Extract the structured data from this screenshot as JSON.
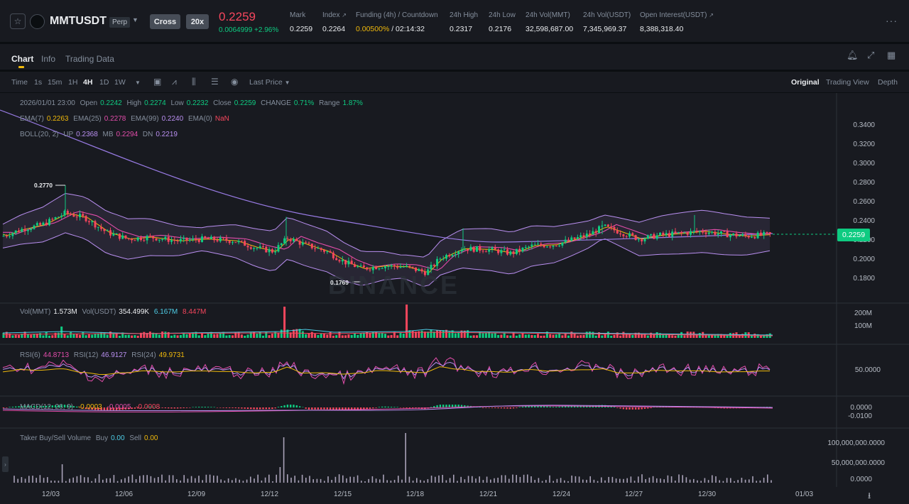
{
  "header": {
    "symbol": "MMTUSDT",
    "contract_type": "Perp",
    "margin_mode": "Cross",
    "leverage": "20x",
    "last_price": "0.2259",
    "price_change": "0.0064999 +2.96%",
    "stats": [
      {
        "label": "Mark",
        "value": "0.2259"
      },
      {
        "label": "Index",
        "value": "0.2264"
      },
      {
        "label": "Funding (4h) / Countdown",
        "value_funding": "0.00500%",
        "value_countdown": "/ 02:14:32"
      },
      {
        "label": "24h High",
        "value": "0.2317"
      },
      {
        "label": "24h Low",
        "value": "0.2176"
      },
      {
        "label": "24h Vol(MMT)",
        "value": "32,598,687.00"
      },
      {
        "label": "24h Vol(USDT)",
        "value": "7,345,969.37"
      },
      {
        "label": "Open Interest(USDT)",
        "value": "8,388,318.40"
      }
    ]
  },
  "tabs": [
    "Chart",
    "Info",
    "Trading Data"
  ],
  "toolbar": {
    "intervals": [
      "Time",
      "1s",
      "15m",
      "1H",
      "4H",
      "1D",
      "1W"
    ],
    "active_interval": "4H",
    "price_type": "Last Price",
    "views": [
      "Original",
      "Trading View",
      "Depth"
    ],
    "active_view": "Original"
  },
  "legend": {
    "ohlc": {
      "date": "2026/01/01 23:00",
      "open_label": "Open",
      "open": "0.2242",
      "high_label": "High",
      "high": "0.2274",
      "low_label": "Low",
      "low": "0.2232",
      "close_label": "Close",
      "close": "0.2259",
      "change_label": "CHANGE",
      "change": "0.71%",
      "range_label": "Range",
      "range": "1.87%"
    },
    "ema": {
      "ema7_label": "EMA(7)",
      "ema7": "0.2263",
      "ema25_label": "EMA(25)",
      "ema25": "0.2278",
      "ema99_label": "EMA(99)",
      "ema99": "0.2240",
      "ema0_label": "EMA(0)",
      "ema0": "NaN"
    },
    "boll": {
      "label": "BOLL(20, 2)",
      "up_label": "UP",
      "up": "0.2368",
      "mb_label": "MB",
      "mb": "0.2294",
      "dn_label": "DN",
      "dn": "0.2219"
    },
    "vol": {
      "mmt_label": "Vol(MMT)",
      "mmt": "1.573M",
      "usdt_label": "Vol(USDT)",
      "usdt": "354.499K",
      "ma1": "6.167M",
      "ma2": "8.447M"
    },
    "rsi": {
      "rsi6_label": "RSI(6)",
      "rsi6": "44.8713",
      "rsi12_label": "RSI(12)",
      "rsi12": "46.9127",
      "rsi24_label": "RSI(24)",
      "rsi24": "49.9731"
    },
    "macd": {
      "label": "MACD(12, 26, 9)",
      "v1": "-0.0003",
      "v2": "-0.0005",
      "v3": "-0.0008"
    },
    "taker": {
      "label": "Taker Buy/Sell Volume",
      "buy_label": "Buy",
      "buy": "0.00",
      "sell_label": "Sell",
      "sell": "0.00"
    }
  },
  "price_axis": [
    "0.3400",
    "0.3200",
    "0.3000",
    "0.2800",
    "0.2600",
    "0.2400",
    "0.2200",
    "0.2000",
    "0.1800"
  ],
  "current_price_tag": "0.2259",
  "annotations": {
    "high": "0.2770",
    "low": "0.1769"
  },
  "volume_axis": [
    "200M",
    "100M"
  ],
  "rsi_axis": [
    "50.0000"
  ],
  "macd_axis": [
    "0.0000",
    "-0.0100"
  ],
  "taker_axis": [
    "100,000,000.0000",
    "50,000,000.0000",
    "0.0000"
  ],
  "date_axis": [
    "12/03",
    "12/06",
    "12/09",
    "12/12",
    "12/15",
    "12/18",
    "12/21",
    "12/24",
    "12/27",
    "12/30",
    "01/03"
  ],
  "watermark": "BINANCE",
  "colors": {
    "up": "#0ecb81",
    "down": "#f6465d",
    "accent": "#f0b90b",
    "bg": "#181a20"
  }
}
